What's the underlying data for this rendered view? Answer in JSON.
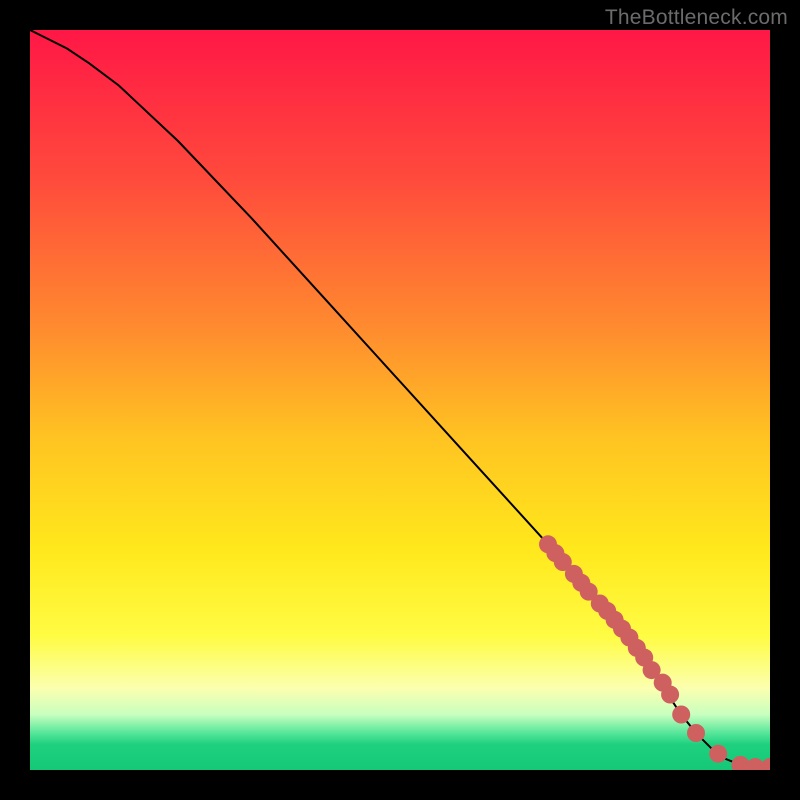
{
  "watermark": "TheBottleneck.com",
  "chart_data": {
    "type": "line",
    "title": "",
    "xlabel": "",
    "ylabel": "",
    "xlim": [
      0,
      100
    ],
    "ylim": [
      0,
      100
    ],
    "background_gradient_stops": [
      {
        "offset": 0.0,
        "color": "#ff1746"
      },
      {
        "offset": 0.2,
        "color": "#ff4a3c"
      },
      {
        "offset": 0.4,
        "color": "#ff8a2f"
      },
      {
        "offset": 0.55,
        "color": "#ffc322"
      },
      {
        "offset": 0.7,
        "color": "#ffe81c"
      },
      {
        "offset": 0.82,
        "color": "#fffc44"
      },
      {
        "offset": 0.89,
        "color": "#fbffb0"
      },
      {
        "offset": 0.925,
        "color": "#c8ffbf"
      },
      {
        "offset": 0.95,
        "color": "#56e69a"
      },
      {
        "offset": 0.965,
        "color": "#1fd17f"
      },
      {
        "offset": 1.0,
        "color": "#14c877"
      }
    ],
    "series": [
      {
        "name": "curve",
        "kind": "line",
        "x": [
          0,
          2,
          5,
          8,
          12,
          20,
          30,
          40,
          50,
          60,
          70,
          78,
          82,
          84,
          86,
          88,
          90,
          92,
          94,
          96,
          98,
          100
        ],
        "y": [
          100,
          99,
          97.5,
          95.5,
          92.5,
          85,
          74.5,
          63.5,
          52.5,
          41.5,
          30.5,
          21.5,
          16.5,
          13.5,
          10.5,
          7.5,
          5,
          3,
          1.5,
          0.7,
          0.4,
          0.4
        ]
      },
      {
        "name": "markers",
        "kind": "scatter",
        "x": [
          70,
          71,
          72,
          73.5,
          74.5,
          75.5,
          77,
          78,
          79,
          80,
          81,
          82,
          83,
          84,
          85.5,
          86.5,
          88,
          90,
          93,
          96,
          98,
          100
        ],
        "y": [
          30.5,
          29.3,
          28.1,
          26.5,
          25.3,
          24.1,
          22.5,
          21.5,
          20.3,
          19.1,
          17.9,
          16.5,
          15.2,
          13.5,
          11.8,
          10.2,
          7.5,
          5.0,
          2.2,
          0.7,
          0.4,
          0.4
        ],
        "color": "#cf6060",
        "radius": 9
      }
    ]
  }
}
